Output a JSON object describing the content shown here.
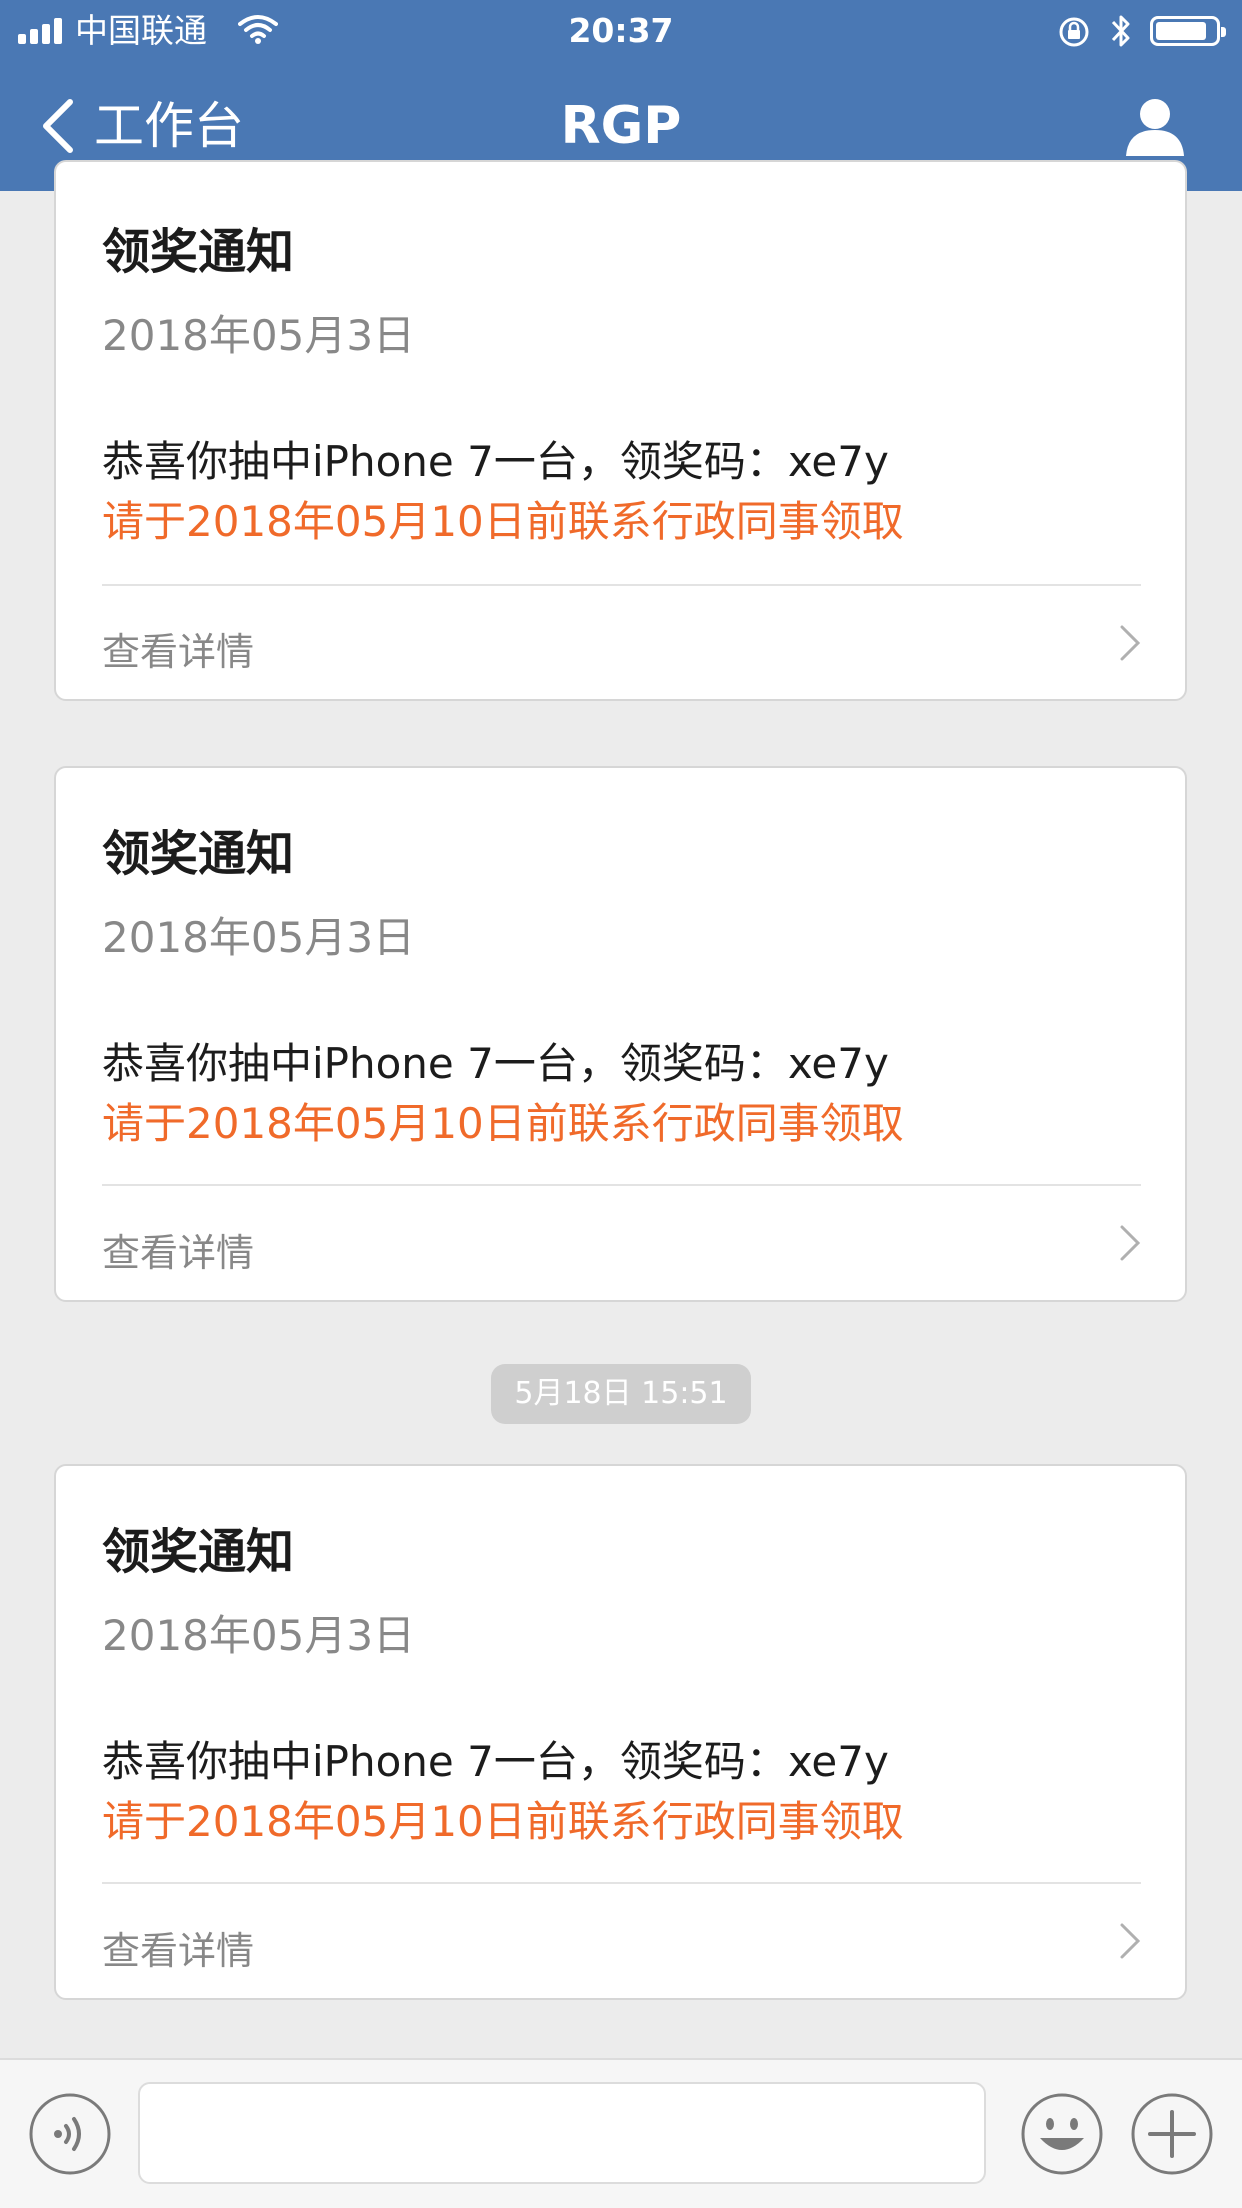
{
  "status_bar": {
    "carrier": "中国联通",
    "time": "20:37"
  },
  "nav": {
    "back_label": "工作台",
    "title": "RGP"
  },
  "cards": [
    {
      "title": "领奖通知",
      "date": "2018年05月3日",
      "message": "恭喜你抽中iPhone 7一台，领奖码：xe7y",
      "deadline": "请于2018年05月10日前联系行政同事领取",
      "detail_link": "查看详情"
    },
    {
      "title": "领奖通知",
      "date": "2018年05月3日",
      "message": "恭喜你抽中iPhone 7一台，领奖码：xe7y",
      "deadline": "请于2018年05月10日前联系行政同事领取",
      "detail_link": "查看详情"
    },
    {
      "title": "领奖通知",
      "date": "2018年05月3日",
      "message": "恭喜你抽中iPhone 7一台，领奖码：xe7y",
      "deadline": "请于2018年05月10日前联系行政同事领取",
      "detail_link": "查看详情"
    }
  ],
  "timestamp_pill": "5月18日 15:51",
  "input_bar": {
    "value": "",
    "icons": [
      "voice-icon",
      "emoji-icon",
      "plus-icon"
    ]
  },
  "colors": {
    "header": "#4a78b4",
    "accent_orange": "#f06a2a",
    "background": "#ececec"
  }
}
